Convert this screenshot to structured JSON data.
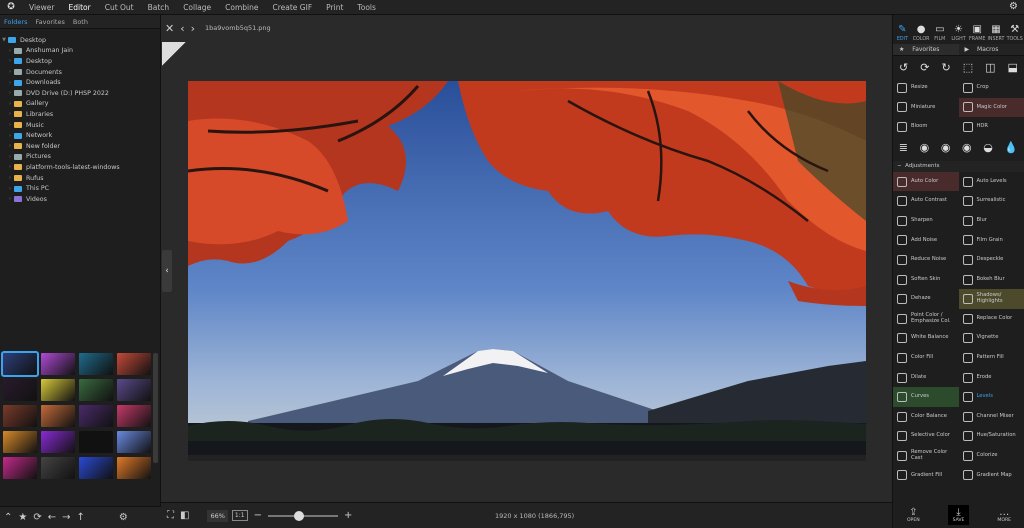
{
  "menu": [
    "Viewer",
    "Editor",
    "Cut Out",
    "Batch",
    "Collage",
    "Combine",
    "Create GIF",
    "Print",
    "Tools"
  ],
  "menu_active": "Editor",
  "left_tabs": [
    "Folders",
    "Favorites",
    "Both"
  ],
  "tree": [
    {
      "label": "Desktop",
      "color": "blue",
      "level": 0
    },
    {
      "label": "Anshuman Jain",
      "color": "gray",
      "level": 1
    },
    {
      "label": "Desktop",
      "color": "blue",
      "level": 1
    },
    {
      "label": "Documents",
      "color": "gray",
      "level": 1
    },
    {
      "label": "Downloads",
      "color": "blue",
      "level": 1
    },
    {
      "label": "DVD Drive (D:) PHSP 2022",
      "color": "gray",
      "level": 1
    },
    {
      "label": "Gallery",
      "color": "yellow",
      "level": 1
    },
    {
      "label": "Libraries",
      "color": "yellow",
      "level": 1
    },
    {
      "label": "Music",
      "color": "yellow",
      "level": 1
    },
    {
      "label": "Network",
      "color": "blue",
      "level": 1
    },
    {
      "label": "New folder",
      "color": "yellow",
      "level": 1
    },
    {
      "label": "Pictures",
      "color": "gray",
      "level": 1
    },
    {
      "label": "platform-tools-latest-windows",
      "color": "yellow",
      "level": 1
    },
    {
      "label": "Rufus",
      "color": "yellow",
      "level": 1
    },
    {
      "label": "This PC",
      "color": "blue",
      "level": 1
    },
    {
      "label": "Videos",
      "color": "purple",
      "level": 1
    }
  ],
  "thumb_colors": [
    "#2c3f7a",
    "#b04bd6",
    "#1f6b8c",
    "#c44a3a",
    "#2a1a2e",
    "#d7c83a",
    "#3a6a3f",
    "#5a4a8a",
    "#7a3b2a",
    "#c46b3a",
    "#4a2b6a",
    "#c43a6a",
    "#d68a2a",
    "#8a2ad6",
    "#111111",
    "#6a8ae0",
    "#c42a8a",
    "#444444",
    "#2a4ad6",
    "#e07a2a"
  ],
  "filename": "1ba9vomb5q51.png",
  "zoom": "66%",
  "ratio": "1:1",
  "dims": "1920 x 1080 (1866,795)",
  "right_tools": [
    {
      "label": "EDIT",
      "icon": "✎",
      "active": true
    },
    {
      "label": "COLOR",
      "icon": "●"
    },
    {
      "label": "FILM",
      "icon": "▭"
    },
    {
      "label": "LIGHT",
      "icon": "☀"
    },
    {
      "label": "FRAME",
      "icon": "▣"
    },
    {
      "label": "INSERT",
      "icon": "▦"
    },
    {
      "label": "TOOLS",
      "icon": "⚒"
    }
  ],
  "right_tabs": [
    "Favorites",
    "Macros"
  ],
  "quick_items": [
    "Resize",
    "Crop",
    "Miniature",
    "Magic Color",
    "Bloom",
    "HDR"
  ],
  "adjustments_label": "Adjustments",
  "adjustments": [
    "Auto Color",
    "Auto Levels",
    "Auto Contrast",
    "Surrealistic",
    "Sharpen",
    "Blur",
    "Add Noise",
    "Film Grain",
    "Reduce Noise",
    "Despeckle",
    "Soften Skin",
    "Bokeh Blur",
    "Dehaze",
    "Shadows/ Highlights",
    "Point Color / Emphasize Col.",
    "Replace Color",
    "White Balance",
    "Vignette",
    "Color Fill",
    "Pattern Fill",
    "Dilate",
    "Erode",
    "Curves",
    "Levels",
    "Color Balance",
    "Channel Mixer",
    "Selective Color",
    "Hue/Saturation",
    "Remove Color Cast",
    "Colorize",
    "Gradient Fill",
    "Gradient Map"
  ],
  "right_bottom": [
    {
      "label": "OPEN",
      "icon": "⇪"
    },
    {
      "label": "SAVE",
      "icon": "⤓",
      "active": true
    },
    {
      "label": "MORE",
      "icon": "…"
    }
  ]
}
